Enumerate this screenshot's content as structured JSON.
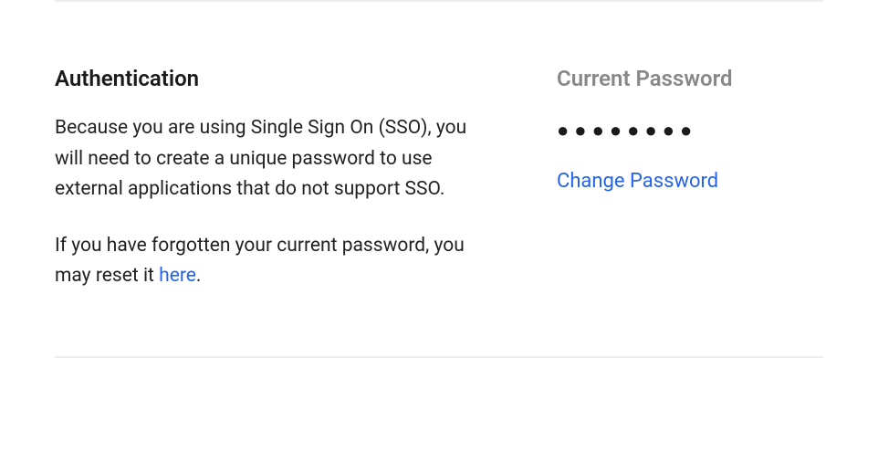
{
  "authentication": {
    "title": "Authentication",
    "description": "Because you are using Single Sign On (SSO), you will need to create a unique password to use external applications that do not support SSO.",
    "forgot_text_prefix": "If you have forgotten your current password, you may reset it ",
    "forgot_link_text": "here",
    "forgot_text_suffix": "."
  },
  "password": {
    "label": "Current Password",
    "masked_value": "●●●●●●●●",
    "change_link_text": "Change Password"
  }
}
